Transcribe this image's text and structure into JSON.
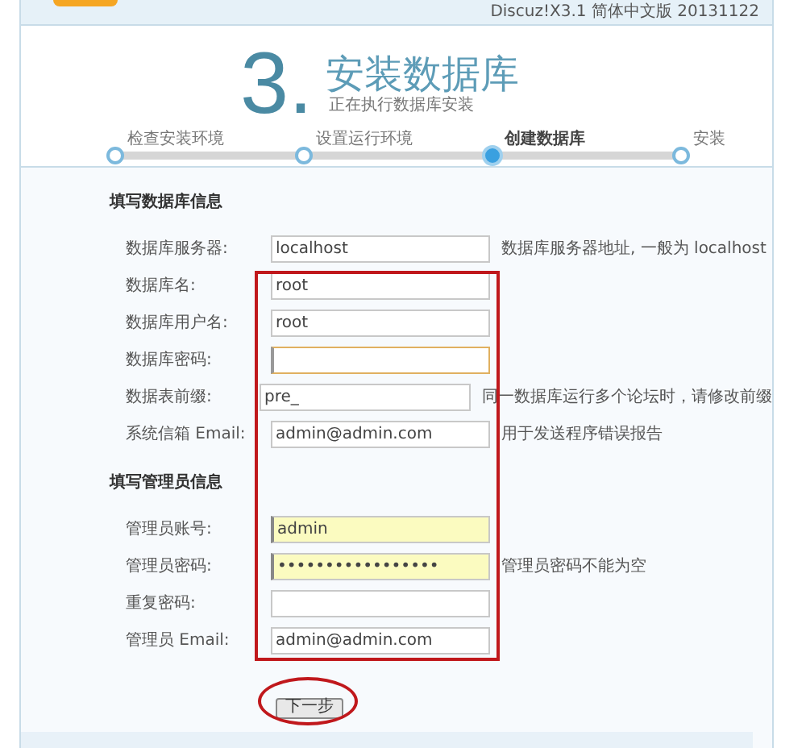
{
  "header": {
    "version": "Discuz!X3.1 简体中文版 20131122"
  },
  "title": {
    "number": "3.",
    "heading": "安装数据库",
    "subtitle": "正在执行数据库安装"
  },
  "steps": [
    {
      "label": "检查安装环境",
      "selected": false
    },
    {
      "label": "设置运行环境",
      "selected": false
    },
    {
      "label": "创建数据库",
      "selected": true
    },
    {
      "label": "安装",
      "selected": false
    }
  ],
  "sections": [
    {
      "heading": "填写数据库信息",
      "fields": [
        {
          "label": "数据库服务器:",
          "value": "localhost",
          "hint": "数据库服务器地址, 一般为 localhost",
          "focused": false,
          "autofilled": false
        },
        {
          "label": "数据库名:",
          "value": "root",
          "focused": false,
          "autofilled": false
        },
        {
          "label": "数据库用户名:",
          "value": "root",
          "focused": false,
          "autofilled": false
        },
        {
          "label": "数据库密码:",
          "focused": true,
          "autofilled": false
        },
        {
          "label": "数据表前缀:",
          "value": "pre_",
          "hint": "同一数据库运行多个论坛时，请修改前缀",
          "focused": false,
          "autofilled": false
        },
        {
          "label": "系统信箱 Email:",
          "value": "admin@admin.com",
          "hint": "用于发送程序错误报告",
          "focused": false,
          "autofilled": false
        }
      ]
    },
    {
      "heading": "填写管理员信息",
      "fields": [
        {
          "label": "管理员账号:",
          "value": "admin",
          "focused": false,
          "autofilled": true
        },
        {
          "label": "管理员密码:",
          "value": "•••••••••••••••••",
          "hint": "管理员密码不能为空",
          "focused": false,
          "autofilled": true
        },
        {
          "label": "重复密码:",
          "focused": false,
          "autofilled": false
        },
        {
          "label": "管理员 Email:",
          "value": "admin@admin.com",
          "focused": false,
          "autofilled": false
        }
      ]
    }
  ],
  "next_button": "下一步",
  "annotations": [
    {
      "kind": "rectangle"
    },
    {
      "kind": "ellipse"
    }
  ]
}
